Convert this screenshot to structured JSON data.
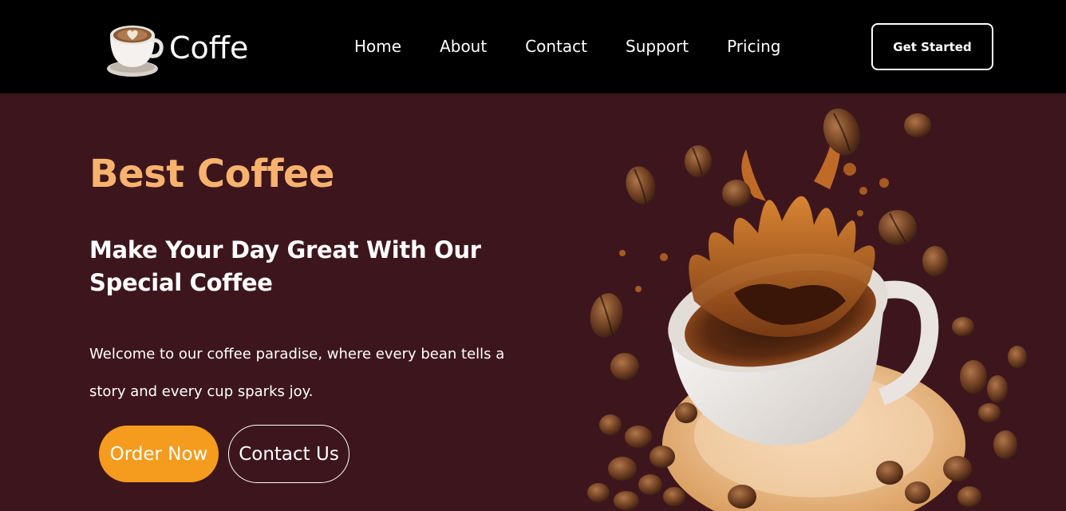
{
  "brand": {
    "name": "Coffe",
    "logo_icon": "coffee-cup-icon"
  },
  "nav": {
    "items": [
      {
        "label": "Home"
      },
      {
        "label": "About"
      },
      {
        "label": "Contact"
      },
      {
        "label": "Support"
      },
      {
        "label": "Pricing"
      }
    ],
    "cta_label": "Get Started"
  },
  "hero": {
    "kicker": "Best Coffee",
    "title": "Make Your Day Great With Our Special Coffee",
    "description": "Welcome to our coffee paradise, where every bean tells a story and every cup sparks joy.",
    "primary_button": "Order Now",
    "secondary_button": "Contact Us",
    "image_icon": "coffee-splash-image"
  },
  "colors": {
    "nav_bg": "#000000",
    "hero_bg": "#3d161d",
    "accent_orange": "#f59b1e",
    "kicker_color": "#f7b26e"
  }
}
